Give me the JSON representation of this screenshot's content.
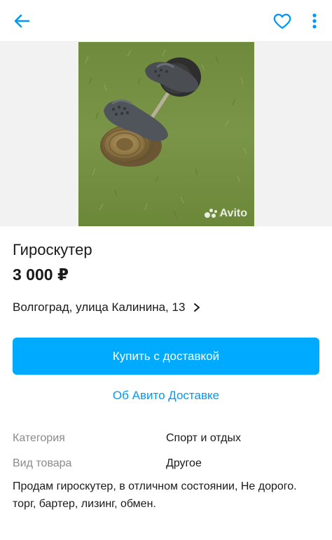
{
  "header": {
    "back_icon": "arrow-left-icon",
    "favorite_icon": "heart-outline-icon",
    "more_icon": "more-vertical-icon",
    "accent": "#0099f7"
  },
  "gallery": {
    "image_alt": "Гироскутер",
    "watermark": "Avito"
  },
  "listing": {
    "title": "Гироскутер",
    "price": "3 000 ₽",
    "address": "Волгоград, улица Калинина, 13"
  },
  "actions": {
    "buy_label": "Купить с доставкой",
    "buy_color": "#00aaff",
    "about_delivery_label": "Об Авито Доставке"
  },
  "params": [
    {
      "key": "Категория",
      "value": "Спорт и отдых"
    },
    {
      "key": "Вид товара",
      "value": "Другое"
    }
  ],
  "description": {
    "line1": "Продам гироскутер, в отличном состоянии, Не дорого.",
    "line2": "торг, бартер, лизинг, обмен."
  }
}
